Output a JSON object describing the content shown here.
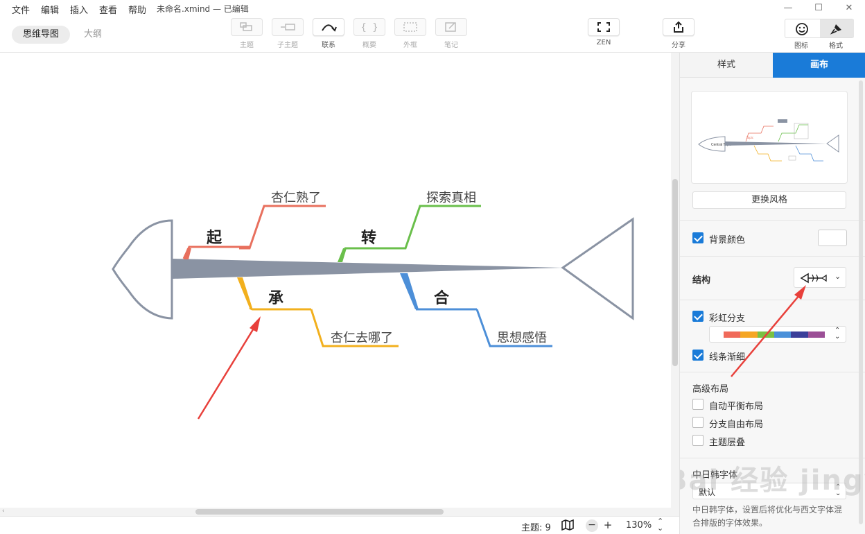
{
  "menu": [
    "文件",
    "编辑",
    "插入",
    "查看",
    "帮助"
  ],
  "window_title": "未命名.xmind — 已编辑",
  "window_controls": {
    "minimize": "—",
    "maximize": "☐",
    "close": "✕"
  },
  "view_tabs": [
    "思维导图",
    "大纲"
  ],
  "tools": {
    "topic": "主题",
    "subtopic": "子主题",
    "relationship": "联系",
    "summary": "概要",
    "boundary": "外框",
    "notes": "笔记",
    "zen": "ZEN",
    "share": "分享",
    "icons": "图标",
    "format": "格式"
  },
  "mindmap": {
    "main_topics": [
      "起",
      "承",
      "转",
      "合"
    ],
    "subtopics": [
      "杏仁熟了",
      "杏仁去哪了",
      "探索真相",
      "思想感悟"
    ],
    "colors": {
      "spine": "#8a93a3",
      "head_outline": "#8a93a3",
      "branch_1": "#e8705e",
      "branch_2": "#f2b01e",
      "branch_3": "#6abf4b",
      "branch_4": "#4d8fd8",
      "annotation_arrow": "#e8403b"
    }
  },
  "status": {
    "topic_count": "主题: 9",
    "zoom_out": "−",
    "zoom_in": "+",
    "zoom_level": "130%"
  },
  "panel": {
    "tabs": [
      "样式",
      "画布"
    ],
    "active_tab": "画布",
    "accent_color": "#1a7bd8",
    "preview": {
      "central_topic": "Central Topic",
      "topic": "Topic"
    },
    "change_style_button": "更换风格",
    "background_color": {
      "label": "背景颜色",
      "checked": true,
      "value": "#ffffff"
    },
    "structure_label": "结构",
    "rainbow_branch": {
      "label": "彩虹分支",
      "checked": true,
      "colors": [
        "#f06a5a",
        "#f5a623",
        "#7ac143",
        "#4a90d9",
        "#3b3f9a",
        "#9b4f96"
      ]
    },
    "tapered_lines": {
      "label": "线条渐细",
      "checked": true
    },
    "advanced_layout": {
      "title": "高级布局",
      "options": [
        {
          "label": "自动平衡布局",
          "checked": false
        },
        {
          "label": "分支自由布局",
          "checked": false
        },
        {
          "label": "主题层叠",
          "checked": false
        }
      ]
    },
    "cjk_font": {
      "title": "中日韩字体",
      "value": "默认",
      "description": "中日韩字体，设置后将优化与西文字体混合排版的字体效果。"
    }
  },
  "watermark": "Bai 经验 jingyan.baidu.com"
}
